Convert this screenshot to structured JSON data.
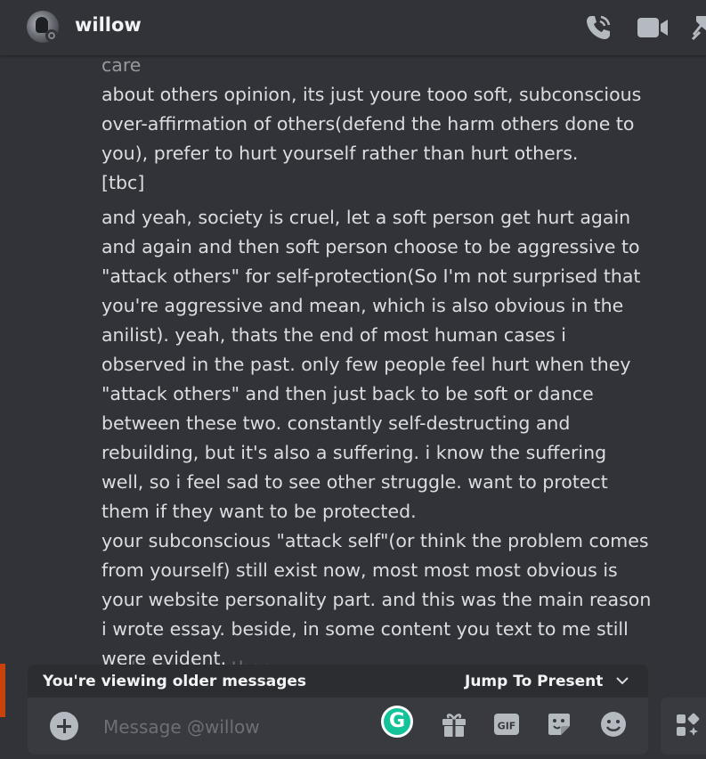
{
  "header": {
    "username": "willow",
    "icons": [
      "avatar",
      "voice-call-icon",
      "video-call-icon",
      "pinned-messages-icon"
    ]
  },
  "messages": {
    "top_partial": "depression and eating disorder its not like you were too care",
    "paragraphs": [
      "about others opinion, its just youre tooo soft, subconscious over-affirmation of others(defend the harm others done to you), prefer to hurt yourself rather than hurt others.",
      "[tbc]",
      "and yeah, society is cruel, let a soft person get hurt again and again and then soft person choose to be aggressive to \"attack others\" for self-protection(So I'm not surprised that you're aggressive and mean, which is also obvious in the anilist). yeah, thats the end of most human cases i observed in the past. only few people feel hurt when they \"attack others\" and then just back to be soft or dance between these two. constantly self-destructing and rebuilding, but it's also a suffering. i know the suffering well, so i feel sad to see other struggle. want to protect them if they want to be protected.",
      "your subconscious \"attack self\"(or think the problem comes from yourself) still exist now, most most most obvious is your website personality part. and this was the main reason i wrote essay. beside, in some content you text to me still were evident."
    ],
    "cut_off_line": "and also the other"
  },
  "older_bar": {
    "notice": "You're viewing older messages",
    "jump_label": "Jump To Present"
  },
  "composer": {
    "placeholder": "Message @willow",
    "grammarly_letter": "G",
    "gif_label": "GIF"
  },
  "colors": {
    "background": "#313338",
    "text": "#dbdee1",
    "composer": "#383a40",
    "grammarly": "#15c39a"
  }
}
